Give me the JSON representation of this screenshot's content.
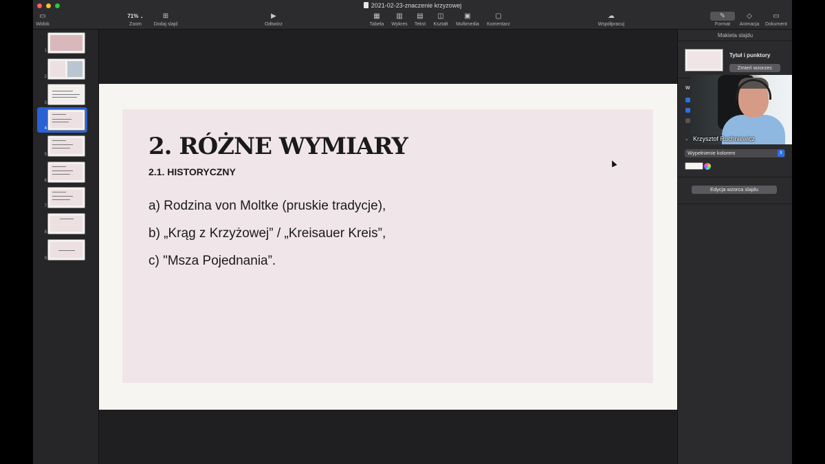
{
  "window": {
    "title": "2021-02-23-znaczenie krzyzowej"
  },
  "toolbar": {
    "view": "Widok",
    "zoom_value": "71%",
    "zoom": "Zoom",
    "add_slide": "Dodaj slajd",
    "play": "Odtwórz",
    "table": "Tabela",
    "chart": "Wykres",
    "text": "Tekst",
    "shape": "Kształt",
    "media": "Multimedia",
    "comment": "Komentarz",
    "collaborate": "Współpracuj",
    "format": "Format",
    "animate": "Animacja",
    "document": "Dokument"
  },
  "navigator": {
    "slides": [
      {
        "number": "1"
      },
      {
        "number": "2"
      },
      {
        "number": "3"
      },
      {
        "number": "4",
        "selected": true
      },
      {
        "number": "5"
      },
      {
        "number": "6"
      },
      {
        "number": "7"
      },
      {
        "number": "8"
      },
      {
        "number": "9"
      }
    ]
  },
  "slide": {
    "title": "2. RÓŻNE WYMIARY",
    "subtitle": "2.1. HISTORYCZNY",
    "items": [
      "a) Rodzina von Moltke (pruskie tradycje),",
      "b) „Krąg z Krzyżowej” / „Kreisauer Kreis”,",
      "c) \"Msza Pojednania”."
    ]
  },
  "inspector": {
    "header": "Makieta slajdu",
    "layout_name": "Tytuł i punktory",
    "change_master": "Zmień wzorzec",
    "w_label": "W",
    "fill_select": "Wypełnienie kolorem",
    "edit_master": "Edycja wzorca slajdu"
  },
  "video": {
    "participant": "Krzysztof Ruchniewicz"
  },
  "colors": {
    "accent": "#2a62d6",
    "slide_panel": "#f0e5e8",
    "slide_bg": "#f7f5f2"
  }
}
